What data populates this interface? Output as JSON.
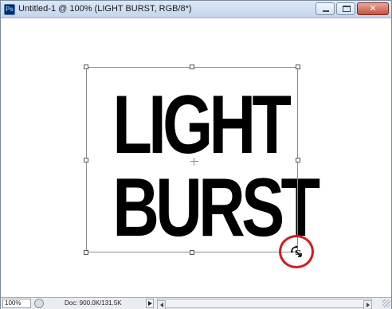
{
  "window": {
    "title": "Untitled-1 @ 100% (LIGHT BURST, RGB/8*)",
    "app_icon_label": "Ps",
    "close_glyph": "✕"
  },
  "canvas": {
    "text_lines": [
      "LIGHT",
      "BURST"
    ],
    "highlight_color": "#cc1e1e"
  },
  "status": {
    "zoom": "100%",
    "doc_info": "Doc: 900.0K/131.5K"
  }
}
